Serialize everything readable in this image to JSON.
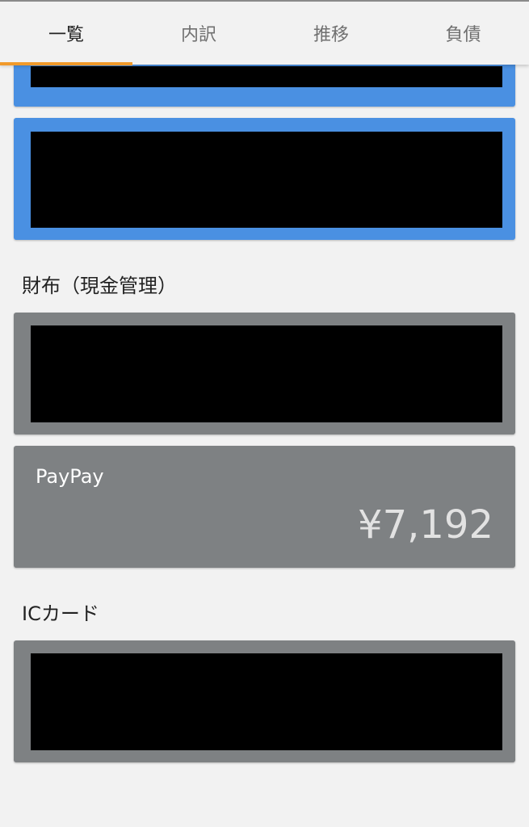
{
  "tabs": [
    {
      "label": "一覧",
      "active": true
    },
    {
      "label": "内訳",
      "active": false
    },
    {
      "label": "推移",
      "active": false
    },
    {
      "label": "負債",
      "active": false
    }
  ],
  "sections": {
    "wallet": {
      "heading": "財布（現金管理）"
    },
    "ic_card": {
      "heading": "ICカード"
    }
  },
  "accounts": {
    "paypay": {
      "name": "PayPay",
      "balance": "¥7,192"
    }
  },
  "colors": {
    "accent_tab_indicator": "#f19a2b",
    "bank_card": "#4a90e2",
    "wallet_card": "#7e8183",
    "background": "#f2f2f2",
    "redaction": "#000000"
  }
}
